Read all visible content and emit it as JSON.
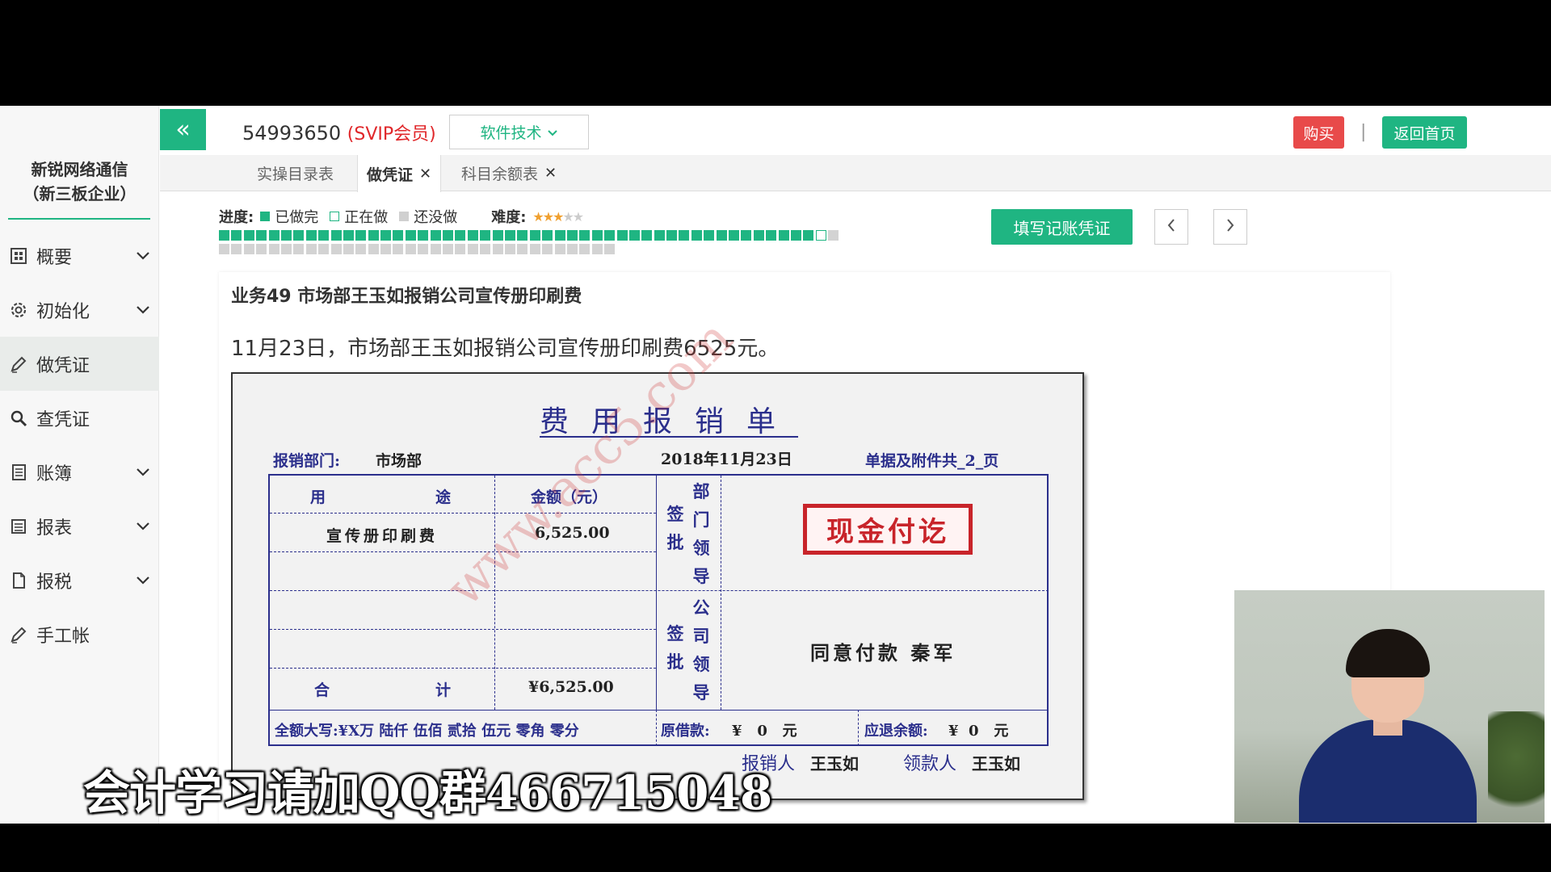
{
  "sidebar": {
    "company_line1": "新锐网络通信",
    "company_line2": "（新三板企业）",
    "items": [
      {
        "label": "概要",
        "icon": "dashboard-icon",
        "has_arrow": true
      },
      {
        "label": "初始化",
        "icon": "gear-icon",
        "has_arrow": true
      },
      {
        "label": "做凭证",
        "icon": "pencil-icon",
        "has_arrow": false,
        "active": true
      },
      {
        "label": "查凭证",
        "icon": "search-icon",
        "has_arrow": false
      },
      {
        "label": "账簿",
        "icon": "ledger-icon",
        "has_arrow": true
      },
      {
        "label": "报表",
        "icon": "report-icon",
        "has_arrow": true
      },
      {
        "label": "报税",
        "icon": "document-icon",
        "has_arrow": true
      },
      {
        "label": "手工帐",
        "icon": "pencil-icon",
        "has_arrow": false
      }
    ]
  },
  "header": {
    "collapse_icon": "«",
    "user_id": "54993650",
    "user_level": "(SVIP会员)",
    "software_menu": "软件技术",
    "buy": "购买",
    "separator": "|",
    "home": "返回首页"
  },
  "tabs": [
    {
      "label": "实操目录表",
      "closable": false
    },
    {
      "label": "做凭证",
      "closable": true,
      "active": true
    },
    {
      "label": "科目余额表",
      "closable": true
    }
  ],
  "progress": {
    "label": "进度:",
    "done_label": "已做完",
    "doing_label": "正在做",
    "todo_label": "还没做",
    "difficulty_label": "难度:",
    "difficulty_stars": 3,
    "difficulty_max": 5,
    "row1_done": 48,
    "row1_doing": 1,
    "row1_todo": 1,
    "row2_todo": 32
  },
  "actions": {
    "fill_voucher": "填写记账凭证",
    "prev": "‹",
    "next": "›"
  },
  "business": {
    "title": "业务49 市场部王玉如报销公司宣传册印刷费",
    "description": "11月23日，市场部王玉如报销公司宣传册印刷费6525元。"
  },
  "receipt": {
    "title": "费用报销单",
    "dept_label": "报销部门:",
    "dept_value": "市场部",
    "date": "2018年11月23日",
    "pages": "单据及附件共_2_页",
    "col_purpose_a": "用",
    "col_purpose_b": "途",
    "col_amount": "金额（元）",
    "item_purpose": "宣传册印刷费",
    "item_amount": "6,525.00",
    "total_a": "合",
    "total_b": "计",
    "total_amount": "¥6,525.00",
    "dept_approval": [
      "部",
      "门",
      "领",
      "导"
    ],
    "dept_sign": [
      "签",
      "批"
    ],
    "company_approval": [
      "公",
      "司",
      "领",
      "导"
    ],
    "company_sign": [
      "签",
      "批"
    ],
    "stamp": "现金付讫",
    "approval_text": "同意付款 秦军",
    "amount_words": "全额大写:¥X万 陆仟 伍佰 贰拾 伍元 零角 零分",
    "borrowed_label": "原借款:",
    "borrowed_value": "¥   0   元",
    "refund_label": "应退余额:",
    "refund_value": "¥  0   元",
    "claimant_label": "报销人",
    "claimant": "王玉如",
    "payee_label": "领款人",
    "payee": "王玉如",
    "watermark": "www.acc5.com"
  },
  "caption": "会计学习请加QQ群466715048",
  "colors": {
    "accent": "#1fb582",
    "danger": "#e84a4a",
    "receipt_ink": "#2b2f8c",
    "stamp": "#c8242a"
  }
}
